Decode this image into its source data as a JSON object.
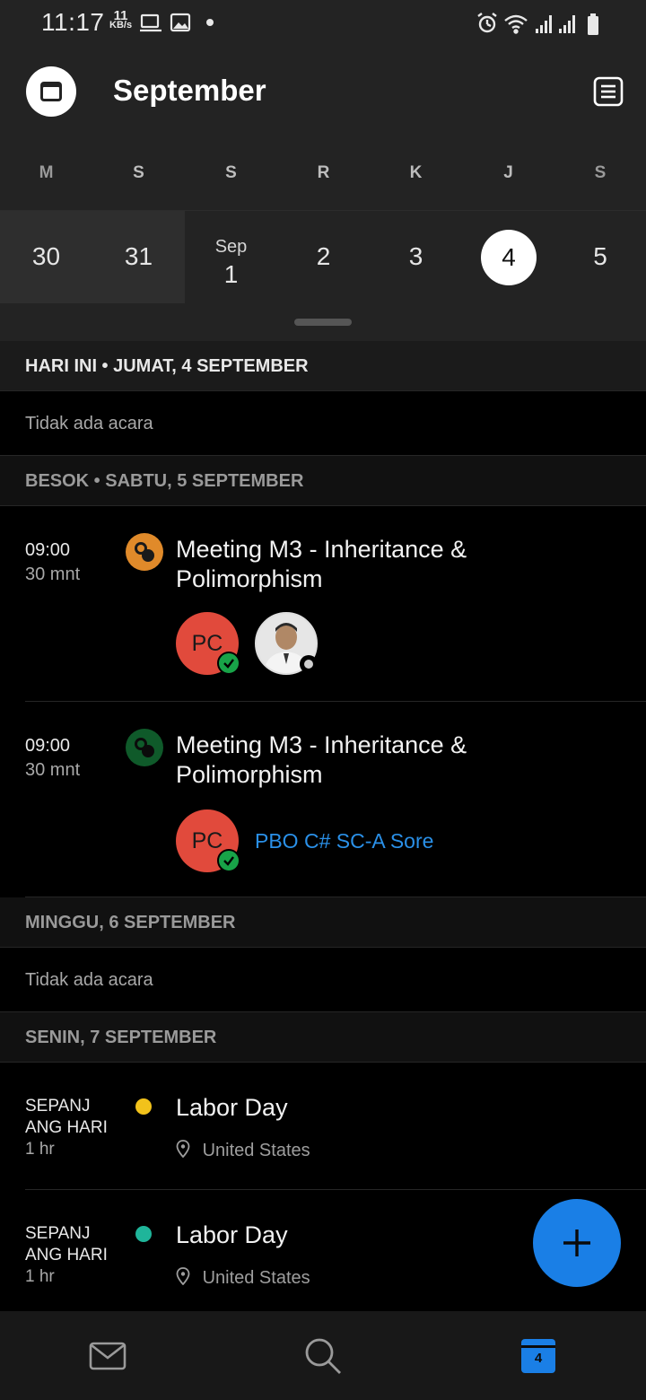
{
  "status_bar": {
    "time": "11:17",
    "net_speed_value": "11",
    "net_speed_unit": "KB/s"
  },
  "header": {
    "title": "September"
  },
  "week": {
    "days": [
      "M",
      "S",
      "S",
      "R",
      "K",
      "J",
      "S"
    ],
    "dates": [
      "30",
      "31",
      "1",
      "2",
      "3",
      "4",
      "5"
    ],
    "month_label": "Sep",
    "selected_date": "4"
  },
  "agenda": {
    "sections": [
      {
        "header": "HARI INI • JUMAT, 4 SEPTEMBER",
        "empty_text": "Tidak ada acara"
      },
      {
        "header": "BESOK • SABTU, 5 SEPTEMBER"
      },
      {
        "header": "MINGGU, 6 SEPTEMBER",
        "empty_text": "Tidak ada acara"
      },
      {
        "header": "SENIN, 7 SEPTEMBER"
      }
    ],
    "events": [
      {
        "time": "09:00",
        "duration": "30 mnt",
        "title": "Meeting M3 - Inheritance & Polimorphism",
        "avatar_initials": "PC",
        "icon_color": "#e08a2a"
      },
      {
        "time": "09:00",
        "duration": "30 mnt",
        "title": "Meeting M3 - Inheritance & Polimorphism",
        "avatar_initials": "PC",
        "group": "PBO C# SC-A Sore",
        "icon_color": "#0f5a2a"
      },
      {
        "time_line1": "SEPANJ",
        "time_line2": "ANG HARI",
        "duration": "1 hr",
        "title": "Labor Day",
        "location": "United States",
        "dot_color": "#f2c21b"
      },
      {
        "time_line1": "SEPANJ",
        "time_line2": "ANG HARI",
        "duration": "1 hr",
        "title": "Labor Day",
        "location": "United States",
        "dot_color": "#1fb59a"
      }
    ]
  },
  "bottom_nav": {
    "calendar_day": "4",
    "active": "calendar"
  },
  "colors": {
    "accent": "#1a7fe6",
    "avatar": "#e14a3c",
    "accepted": "#18a348"
  }
}
